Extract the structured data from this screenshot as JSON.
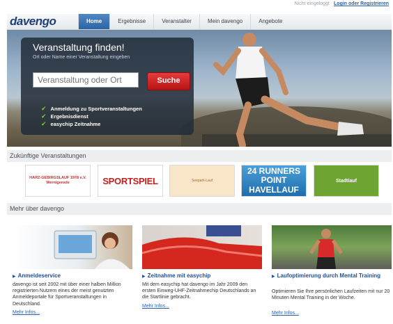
{
  "header": {
    "login_status": "Nicht eingeloggt",
    "login_separator": "·",
    "login_link": "Login oder Registrieren",
    "logo": "davengo"
  },
  "nav": {
    "tabs": [
      {
        "label": "Home",
        "active": true
      },
      {
        "label": "Ergebnisse",
        "active": false
      },
      {
        "label": "Veranstalter",
        "active": false
      },
      {
        "label": "Mein davengo",
        "active": false
      },
      {
        "label": "Angebote",
        "active": false
      }
    ]
  },
  "hero": {
    "title": "Veranstaltung finden!",
    "subtitle": "Ort oder Name einer Veranstaltung eingeben",
    "search_placeholder": "Veranstaltung oder Ort",
    "search_button": "Suche",
    "features": [
      "Anmeldung zu Sportveranstaltungen",
      "Ergebnisdienst",
      "easychip Zeitnahme"
    ]
  },
  "events": {
    "heading": "Zukünftige Veranstaltungen",
    "logos": [
      {
        "text": "HARZ-GEBIRGSLAUF 1978 e.V. Wernigerode"
      },
      {
        "text": "SPORTSPIEL"
      },
      {
        "text": "Seepark-Lauf"
      },
      {
        "text": "24 RUNNERS POINT HAVELLAUF"
      },
      {
        "text": "Stadtlauf"
      }
    ]
  },
  "more": {
    "heading": "Mehr über davengo",
    "cards": [
      {
        "title": "Anmeldeservice",
        "text": "davengo ist seit 2002 mit über einer halben Million registrierten Nutzern eines der meist genutzten Anmeldeportale für Sportveranstaltungen in Deutschland.",
        "link": "Mehr Infos..."
      },
      {
        "title": "Zeitnahme mit easychip",
        "text": "Mit dem easychip hat davengo im Jahr 2009 den ersten Einweg-UHF-Zeitnahmechip Deutschlands an die Startlinie gebracht.",
        "link": "Mehr Infos..."
      },
      {
        "title": "Laufoptimierung durch Mental Training",
        "text": "Optimieren Sie Ihre persönlichen Laufzeiten mit nur 20 Minuten Mental Training in der Woche.",
        "link": "Mehr Infos..."
      }
    ]
  },
  "colors": {
    "accent": "#2e64a4",
    "button_red": "#d42626",
    "check_green": "#7ec742",
    "link_blue": "#2b5ea8"
  }
}
